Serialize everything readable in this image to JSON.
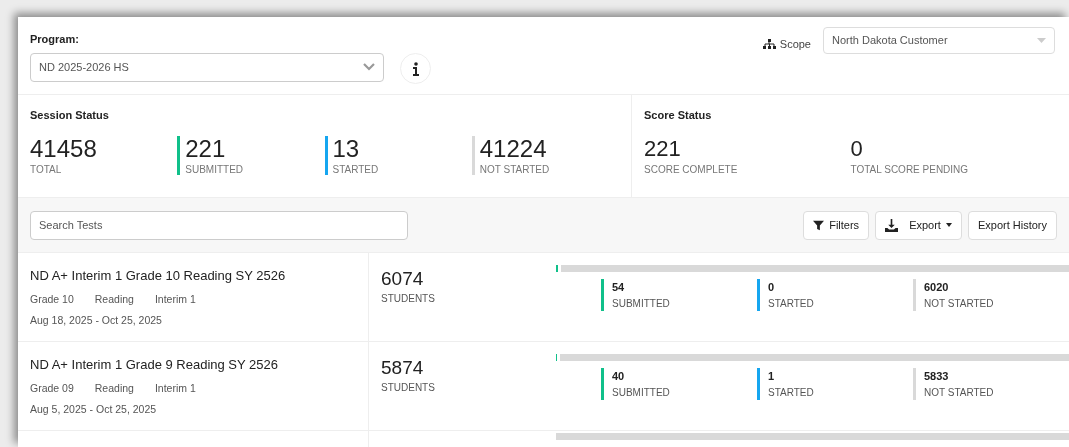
{
  "program": {
    "label": "Program:",
    "value": "ND 2025-2026 HS"
  },
  "scope": {
    "label": "Scope",
    "value": "North Dakota Customer"
  },
  "session_status": {
    "title": "Session Status",
    "items": [
      {
        "value": "41458",
        "label": "TOTAL"
      },
      {
        "value": "221",
        "label": "SUBMITTED",
        "color": "#10c08a"
      },
      {
        "value": "13",
        "label": "STARTED",
        "color": "#16a6f0"
      },
      {
        "value": "41224",
        "label": "NOT STARTED",
        "color": "#d9d9d9"
      }
    ]
  },
  "score_status": {
    "title": "Score Status",
    "items": [
      {
        "value": "221",
        "label": "SCORE COMPLETE"
      },
      {
        "value": "0",
        "label": "TOTAL SCORE PENDING"
      }
    ]
  },
  "search": {
    "placeholder": "Search Tests"
  },
  "buttons": [
    {
      "label": "Filters",
      "kind": "filter"
    },
    {
      "label": "Export",
      "kind": "export"
    },
    {
      "label": "Export History",
      "kind": "plain"
    }
  ],
  "tests": [
    {
      "title": "ND A+ Interim 1 Grade 10 Reading SY 2526",
      "tags": [
        "Grade 10",
        "Reading",
        "Interim 1"
      ],
      "dates": "Aug 18, 2025 - Oct 25, 2025",
      "students": "6074",
      "students_label": "STUDENTS",
      "level": 0.009,
      "counts": [
        {
          "value": "54",
          "label": "SUBMITTED",
          "color": "#10c08a"
        },
        {
          "value": "0",
          "label": "STARTED",
          "color": "#16a6f0"
        },
        {
          "value": "6020",
          "label": "NOT STARTED",
          "color": "#d9d9d9"
        }
      ]
    },
    {
      "title": "ND A+ Interim 1 Grade 9 Reading SY 2526",
      "tags": [
        "Grade 09",
        "Reading",
        "Interim 1"
      ],
      "dates": "Aug 5, 2025 - Oct 25, 2025",
      "students": "5874",
      "students_label": "STUDENTS",
      "level": 0.007,
      "counts": [
        {
          "value": "40",
          "label": "SUBMITTED",
          "color": "#10c08a"
        },
        {
          "value": "1",
          "label": "STARTED",
          "color": "#16a6f0"
        },
        {
          "value": "5833",
          "label": "NOT STARTED",
          "color": "#d9d9d9"
        }
      ]
    }
  ]
}
